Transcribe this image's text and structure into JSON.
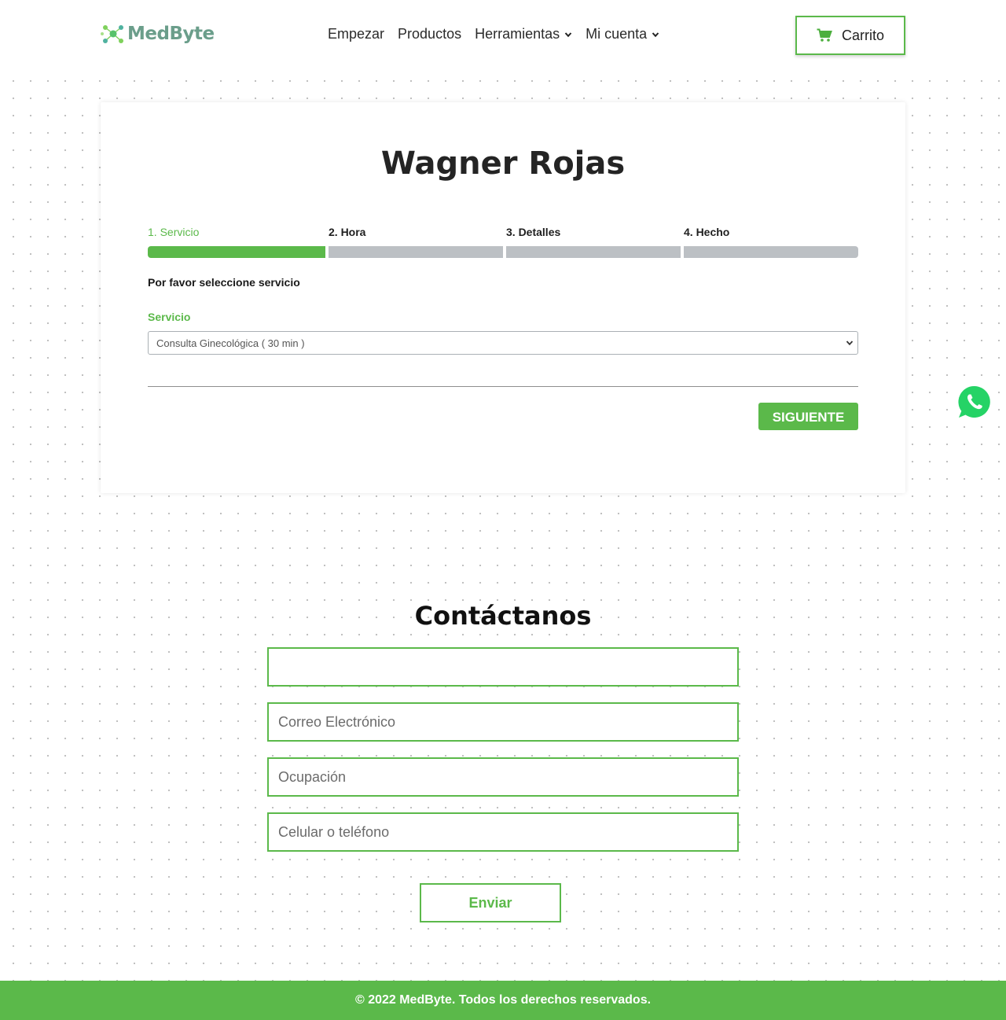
{
  "header": {
    "logo_text": "MedByte",
    "nav": [
      {
        "label": "Empezar"
      },
      {
        "label": "Productos"
      },
      {
        "label": "Herramientas"
      },
      {
        "label": "Mi cuenta"
      }
    ],
    "cart_label": "Carrito"
  },
  "booking": {
    "title": "Wagner Rojas",
    "steps": [
      {
        "label": "1. Servicio",
        "active": true
      },
      {
        "label": "2. Hora",
        "active": false
      },
      {
        "label": "3. Detalles",
        "active": false
      },
      {
        "label": "4. Hecho",
        "active": false
      }
    ],
    "instruction": "Por favor seleccione servicio",
    "service_label": "Servicio",
    "service_value": "Consulta Ginecológica ( 30 min )",
    "next_label": "SIGUIENTE"
  },
  "contact": {
    "title": "Contáctanos",
    "fields": [
      {
        "value": "",
        "placeholder": ""
      },
      {
        "value": "",
        "placeholder": "Correo Electrónico"
      },
      {
        "value": "",
        "placeholder": "Ocupación"
      },
      {
        "value": "",
        "placeholder": "Celular o teléfono"
      }
    ],
    "send_label": "Enviar"
  },
  "footer": {
    "text": "© 2022 MedByte. Todos los derechos reservados."
  },
  "colors": {
    "accent": "#5bb94a",
    "logo": "#6b9e8b",
    "inactive_step": "#bcc0c4",
    "whatsapp": "#25d366"
  },
  "icons": [
    "molecule-logo-icon",
    "chevron-down-icon",
    "cart-icon",
    "whatsapp-icon"
  ]
}
